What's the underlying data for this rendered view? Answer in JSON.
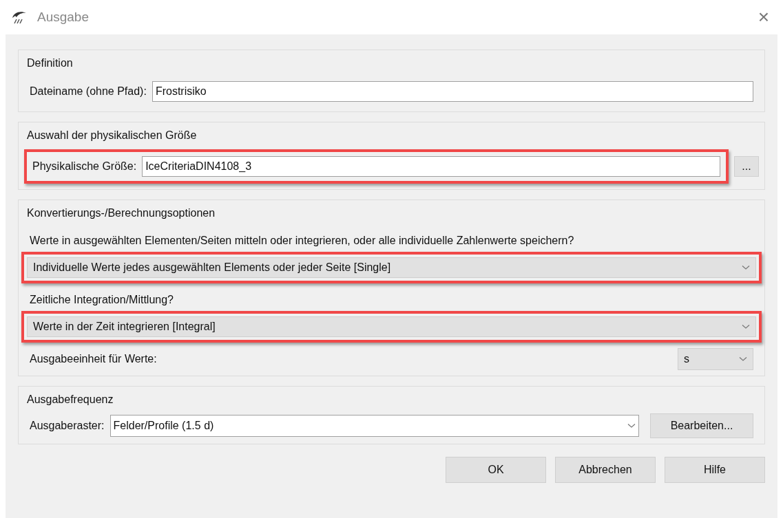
{
  "window": {
    "title": "Ausgabe",
    "close": "×"
  },
  "groups": [
    {
      "title": "Definition",
      "rows": [
        {
          "kind": "text",
          "label": "Dateiname (ohne Pfad):",
          "value": "Frostrisiko",
          "highlighted": false
        }
      ]
    },
    {
      "title": "Auswahl der physikalischen Größe",
      "rows": [
        {
          "kind": "text",
          "label": "Physikalische Größe:",
          "value": "IceCriteriaDIN4108_3",
          "button": "...",
          "highlighted": true
        }
      ]
    },
    {
      "title": "Konvertierungs-/Berechnungsoptionen",
      "rows": [
        {
          "kind": "label",
          "text": "Werte in ausgewählten Elementen/Seiten mitteln oder integrieren, oder alle individuelle Zahlenwerte speichern?"
        },
        {
          "kind": "dropdown",
          "value": "Individuelle Werte jedes ausgewählten Elements oder jeder Seite [Single]",
          "highlighted": true
        },
        {
          "kind": "label",
          "text": "Zeitliche Integration/Mittlung?"
        },
        {
          "kind": "dropdown",
          "value": "Werte in der Zeit integrieren [Integral]",
          "highlighted": true
        },
        {
          "kind": "unit",
          "label": "Ausgabeeinheit für Werte:",
          "value": "s"
        }
      ]
    },
    {
      "title": "Ausgabefrequenz",
      "rows": [
        {
          "kind": "labeled_dropdown",
          "label": "Ausgaberaster:",
          "value": "Felder/Profile (1.5 d)",
          "button": "Bearbeiten..."
        }
      ]
    }
  ],
  "buttons": [
    "OK",
    "Abbrechen",
    "Hilfe"
  ]
}
